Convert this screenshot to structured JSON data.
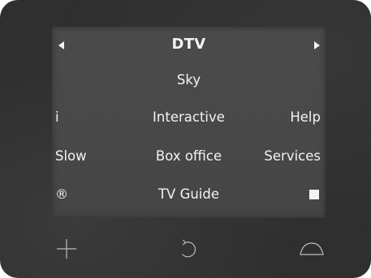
{
  "screen": {
    "title": "DTV",
    "left_arrow_icon": "arrow-left-icon",
    "right_arrow_icon": "arrow-right-icon",
    "sky_label": "Sky",
    "row2": {
      "left": "i",
      "center": "Interactive",
      "right": "Help"
    },
    "row3": {
      "left": "Slow",
      "center": "Box office",
      "right": "Services"
    },
    "row4": {
      "left": "®",
      "center": "TV Guide",
      "right_icon": "stop-square-icon"
    }
  },
  "bottom_icons": [
    "plus-icon",
    "back-icon",
    "dome-icon"
  ],
  "colors": {
    "bezel": "#2f2f2f",
    "screen": "#494949",
    "text": "#f3f3f3",
    "icon": "#bdbdbd"
  }
}
